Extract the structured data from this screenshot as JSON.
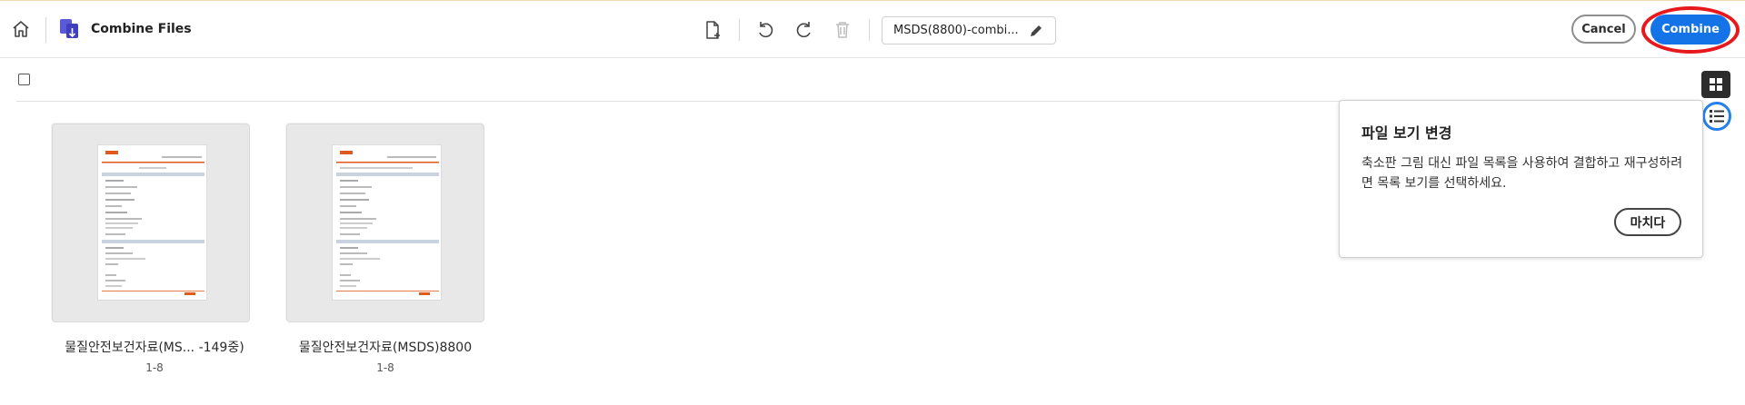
{
  "header": {
    "app_title": "Combine Files",
    "filename": "MSDS(8800)-combi...",
    "cancel_label": "Cancel",
    "combine_label": "Combine"
  },
  "icons": {
    "home": "home-icon",
    "app": "combine-files-icon",
    "add_file": "add-file-icon",
    "undo": "undo-icon",
    "redo": "redo-icon",
    "delete": "trash-icon",
    "edit": "pencil-icon",
    "grid_view": "grid-view-icon",
    "list_view": "list-view-icon"
  },
  "files": [
    {
      "name": "물질안전보건자료(MS... -149중)",
      "pages": "1-8"
    },
    {
      "name": "물질안전보건자료(MSDS)8800",
      "pages": "1-8"
    }
  ],
  "popover": {
    "title": "파일 보기 변경",
    "body": "축소판 그림 대신 파일 목록을 사용하여 결합하고 재구성하려면 목록 보기를 선택하세요.",
    "button_label": "마치다"
  },
  "colors": {
    "accent": "#1473e6",
    "highlight_ring": "#e8191d",
    "list_focus": "#2680eb"
  }
}
